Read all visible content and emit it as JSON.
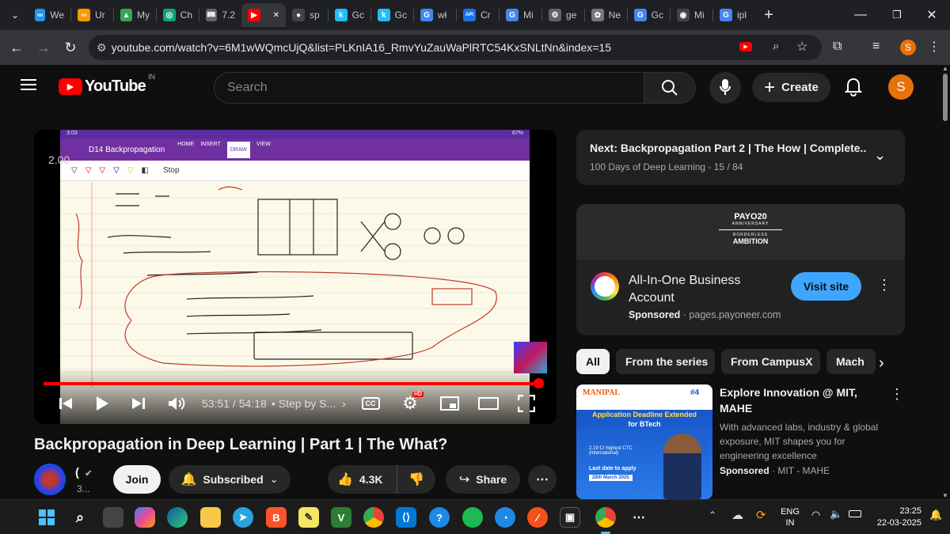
{
  "browser": {
    "tabs": [
      {
        "label": "We",
        "icon": "infinity-icon",
        "color": "#2196f3",
        "glyph": "∞"
      },
      {
        "label": "Ur",
        "icon": "infinity-icon",
        "color": "#ff9800",
        "glyph": "∞"
      },
      {
        "label": "My",
        "icon": "drive-icon",
        "color": "#34a853",
        "glyph": "▲"
      },
      {
        "label": "Ch",
        "icon": "chatgpt-icon",
        "color": "#10a37f",
        "glyph": "◎"
      },
      {
        "label": "7.2",
        "icon": "book-icon",
        "color": "#5f6368",
        "glyph": "📖"
      },
      {
        "label": "",
        "icon": "youtube-icon",
        "color": "#ff0000",
        "glyph": "▶",
        "active": true
      },
      {
        "label": "sp",
        "icon": "github-icon",
        "color": "#444",
        "glyph": "●"
      },
      {
        "label": "Gc",
        "icon": "kaggle-icon",
        "color": "#20beff",
        "glyph": "k"
      },
      {
        "label": "Gc",
        "icon": "kaggle-icon",
        "color": "#20beff",
        "glyph": "k"
      },
      {
        "label": "wł",
        "icon": "google-icon",
        "color": "#4285f4",
        "glyph": "G"
      },
      {
        "label": "Cr",
        "icon": "api-icon",
        "color": "#1a73e8",
        "glyph": "API"
      },
      {
        "label": "Mi",
        "icon": "google-icon",
        "color": "#4285f4",
        "glyph": "G"
      },
      {
        "label": "ge",
        "icon": "settings-icon",
        "color": "#5f6368",
        "glyph": "⚙"
      },
      {
        "label": "Ne",
        "icon": "openai-icon",
        "color": "#777",
        "glyph": "✿"
      },
      {
        "label": "Gc",
        "icon": "google-icon",
        "color": "#4285f4",
        "glyph": "G"
      },
      {
        "label": "Mi",
        "icon": "perplexity-icon",
        "color": "#444",
        "glyph": "◉"
      },
      {
        "label": "ipl",
        "icon": "google-icon",
        "color": "#4285f4",
        "glyph": "G"
      }
    ],
    "url": "youtube.com/watch?v=6M1wWQmcUjQ&list=PLKnIA16_RmvYuZauWaPlRTC54KxSNLtNn&index=15",
    "profile_initial": "S"
  },
  "yt": {
    "logo_text": "YouTube",
    "country": "IN",
    "search_placeholder": "Search",
    "create_label": "Create",
    "avatar_initial": "S"
  },
  "video": {
    "title": "Backpropagation in Deep Learning | Part 1 | The What?",
    "time_current": "53:51",
    "time_total": "54:18",
    "chapter": "• Step by S...",
    "progress": 0.992,
    "speed_overlay": "2.00",
    "hd_badge": "HD",
    "notes_header": "D14 Backpropagation",
    "notes_menu": [
      "HOME",
      "INSERT",
      "DRAW",
      "VIEW"
    ],
    "notes_stop": "Stop",
    "status_time": "3:03",
    "status_battery": "67%"
  },
  "channel": {
    "name": "(",
    "subs": "3...",
    "join_label": "Join",
    "subscribed_label": "Subscribed",
    "likes": "4.3K",
    "share_label": "Share"
  },
  "next_up": {
    "title": "Next: Backpropagation Part 2 | The How | Complete...",
    "subtitle": "100 Days of Deep Learning - 15 / 84"
  },
  "ad": {
    "banner_line1": "PAYO20",
    "banner_line2": "ANNIVERSARY",
    "banner_line3": "BORDERLESS",
    "banner_line4": "AMBITION",
    "title": "All-In-One Business Account",
    "sponsored": "Sponsored",
    "domain": "pages.payoneer.com",
    "cta": "Visit site"
  },
  "chips": [
    "All",
    "From the series",
    "From CampusX",
    "Mach"
  ],
  "promo": {
    "title": "Explore Innovation @ MIT, MAHE",
    "description": "With advanced labs, industry & global exposure, MIT shapes you for engineering excellence",
    "sponsored": "Sponsored",
    "advertiser": "MIT - MAHE",
    "thumb_brand": "MANIPAL",
    "thumb_rank": "#4",
    "thumb_headline": "Application Deadline Extended",
    "thumb_sub": "for BTech",
    "thumb_ctc": "2.19 Cr highest CTC (International)",
    "thumb_deadline_label": "Last date to apply",
    "thumb_deadline": "28th March 2025"
  },
  "taskbar": {
    "lang_top": "ENG",
    "lang_bottom": "IN",
    "time": "23:25",
    "date": "22-03-2025"
  }
}
